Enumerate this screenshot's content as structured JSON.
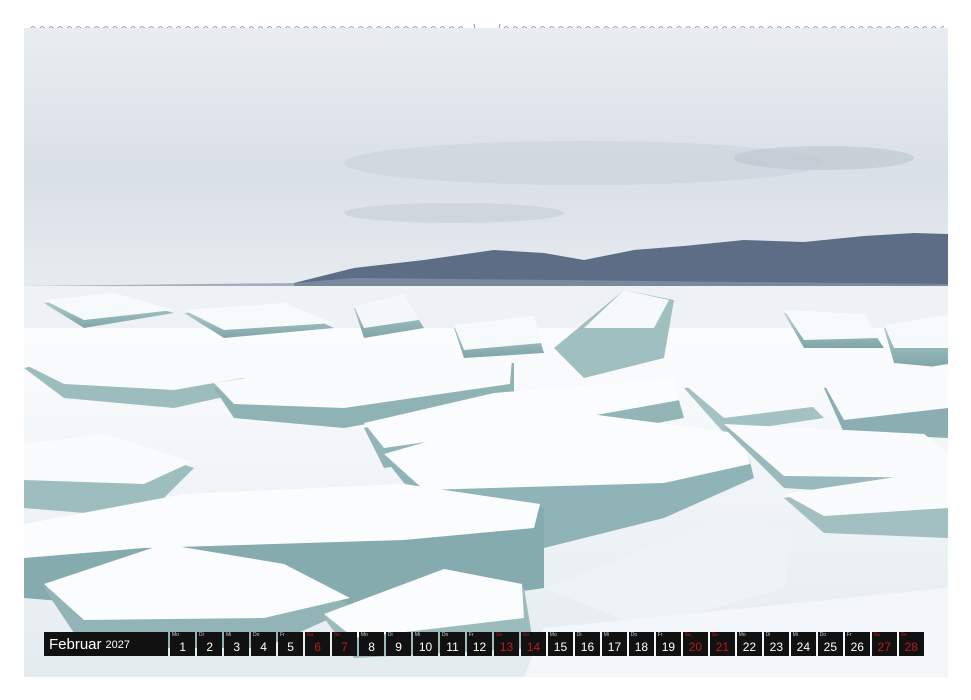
{
  "calendar": {
    "month": "Februar",
    "year": "2027",
    "days": [
      {
        "num": "1",
        "abbr": "Mo",
        "weekend": false
      },
      {
        "num": "2",
        "abbr": "Di",
        "weekend": false
      },
      {
        "num": "3",
        "abbr": "Mi",
        "weekend": false
      },
      {
        "num": "4",
        "abbr": "Do",
        "weekend": false
      },
      {
        "num": "5",
        "abbr": "Fr",
        "weekend": false
      },
      {
        "num": "6",
        "abbr": "Sa",
        "weekend": true
      },
      {
        "num": "7",
        "abbr": "So",
        "weekend": true
      },
      {
        "num": "8",
        "abbr": "Mo",
        "weekend": false
      },
      {
        "num": "9",
        "abbr": "Di",
        "weekend": false
      },
      {
        "num": "10",
        "abbr": "Mi",
        "weekend": false
      },
      {
        "num": "11",
        "abbr": "Do",
        "weekend": false
      },
      {
        "num": "12",
        "abbr": "Fr",
        "weekend": false
      },
      {
        "num": "13",
        "abbr": "Sa",
        "weekend": true
      },
      {
        "num": "14",
        "abbr": "So",
        "weekend": true
      },
      {
        "num": "15",
        "abbr": "Mo",
        "weekend": false
      },
      {
        "num": "16",
        "abbr": "Di",
        "weekend": false
      },
      {
        "num": "17",
        "abbr": "Mi",
        "weekend": false
      },
      {
        "num": "18",
        "abbr": "Do",
        "weekend": false
      },
      {
        "num": "19",
        "abbr": "Fr",
        "weekend": false
      },
      {
        "num": "20",
        "abbr": "Sa",
        "weekend": true
      },
      {
        "num": "21",
        "abbr": "So",
        "weekend": true
      },
      {
        "num": "22",
        "abbr": "Mo",
        "weekend": false
      },
      {
        "num": "23",
        "abbr": "Di",
        "weekend": false
      },
      {
        "num": "24",
        "abbr": "Mi",
        "weekend": false
      },
      {
        "num": "25",
        "abbr": "Do",
        "weekend": false
      },
      {
        "num": "26",
        "abbr": "Fr",
        "weekend": false
      },
      {
        "num": "27",
        "abbr": "Sa",
        "weekend": true
      },
      {
        "num": "28",
        "abbr": "So",
        "weekend": true
      }
    ]
  },
  "colors": {
    "calendar_bar": "#111111",
    "weekend": "#c41818",
    "sky": "#dfe5ea",
    "mountains": "#5d6d86",
    "ice": "#a9c7c8",
    "snow": "#f3f6f8"
  },
  "photo": {
    "subject": "ice-floes-snow-mountains"
  }
}
